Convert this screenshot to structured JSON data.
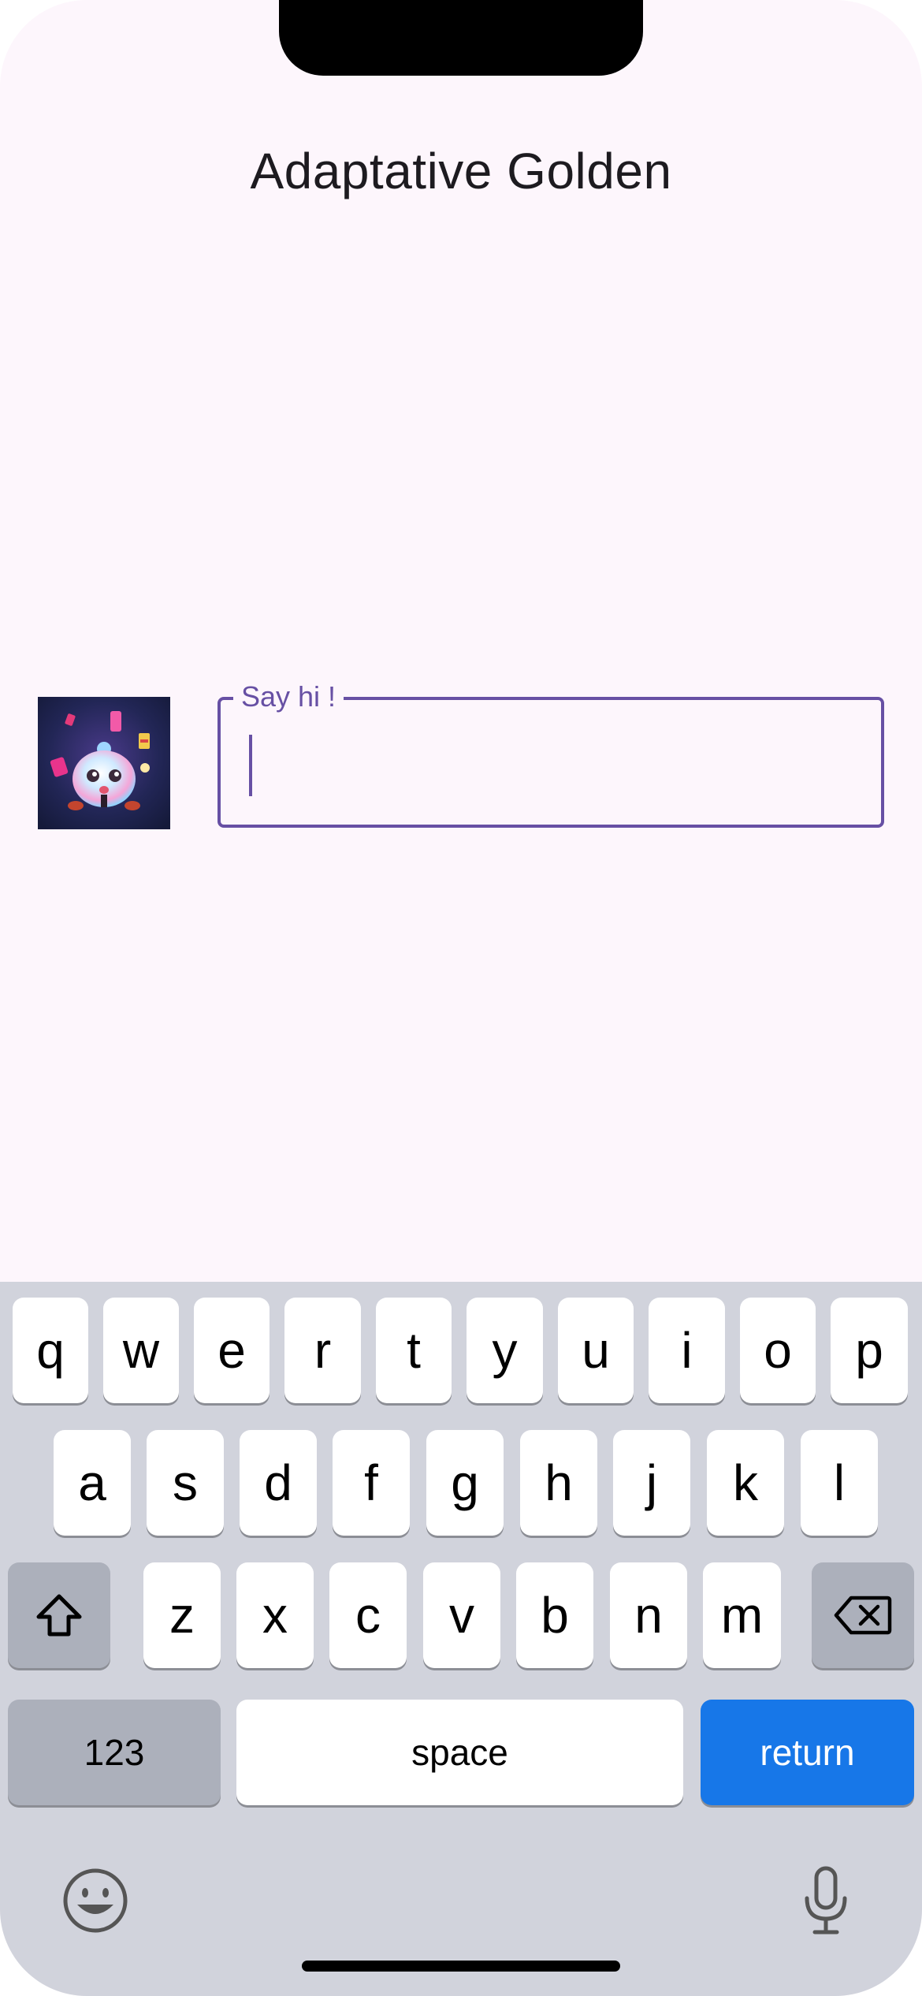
{
  "app": {
    "title": "Adaptative Golden"
  },
  "avatar": {
    "icon": "robot-avatar-image"
  },
  "message_field": {
    "label": "Say hi !",
    "value": ""
  },
  "keyboard": {
    "row1": [
      "q",
      "w",
      "e",
      "r",
      "t",
      "y",
      "u",
      "i",
      "o",
      "p"
    ],
    "row2": [
      "a",
      "s",
      "d",
      "f",
      "g",
      "h",
      "j",
      "k",
      "l"
    ],
    "row3": [
      "z",
      "x",
      "c",
      "v",
      "b",
      "n",
      "m"
    ],
    "numbers_label": "123",
    "space_label": "space",
    "return_label": "return",
    "shift_icon": "shift-icon",
    "backspace_icon": "backspace-icon",
    "emoji_icon": "emoji-icon",
    "mic_icon": "microphone-icon"
  },
  "colors": {
    "accent": "#6750a4",
    "background": "#fdf6fc",
    "keyboard_bg": "#d1d3dc",
    "return_key": "#1777e8"
  }
}
